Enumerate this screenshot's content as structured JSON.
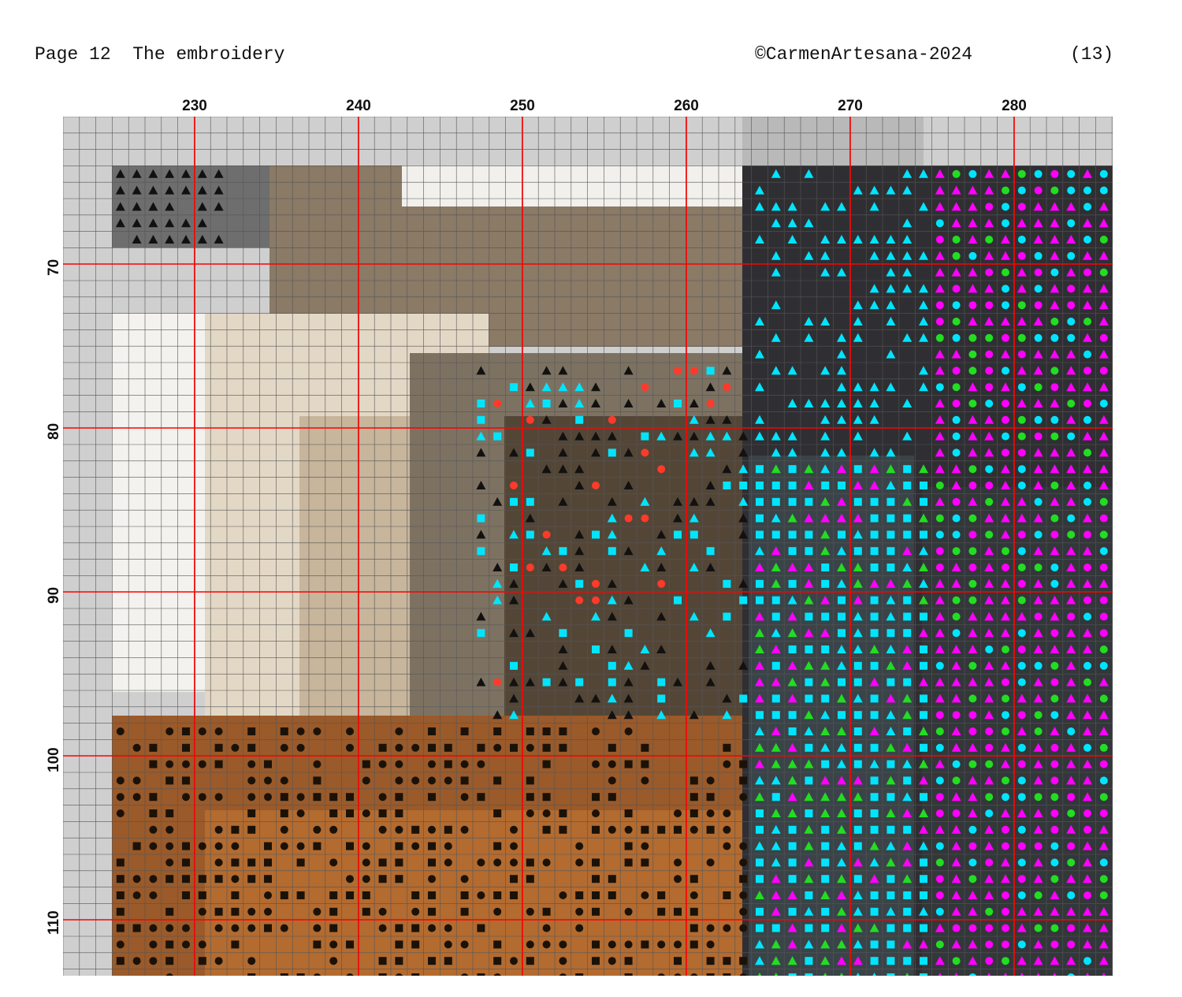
{
  "header": {
    "left": "Page 12  The embroidery",
    "copyright": "©CarmenArtesana-2024",
    "page_number": "(13)"
  },
  "pattern": {
    "column_labels": [
      "230",
      "240",
      "250",
      "260",
      "270",
      "280"
    ],
    "row_labels": [
      "70",
      "80",
      "90",
      "100",
      "110"
    ],
    "palette_colors": {
      "light_gray": "#cfcfcf",
      "dark_gray": "#6e6e6e",
      "white": "#ffffff",
      "cream": "#e6dccb",
      "tan": "#c9b8a0",
      "taupe": "#a08e78",
      "gray_brown": "#7d7262",
      "dark_brown": "#4b3b2c",
      "rust": "#9a5a2a",
      "caramel": "#b36b30",
      "dark_slate": "#2f2f33",
      "cyan": "#00e5ff",
      "magenta": "#ff00ff",
      "green": "#22dd22",
      "red": "#ff3a2a",
      "grid_red": "#ff0000"
    }
  }
}
